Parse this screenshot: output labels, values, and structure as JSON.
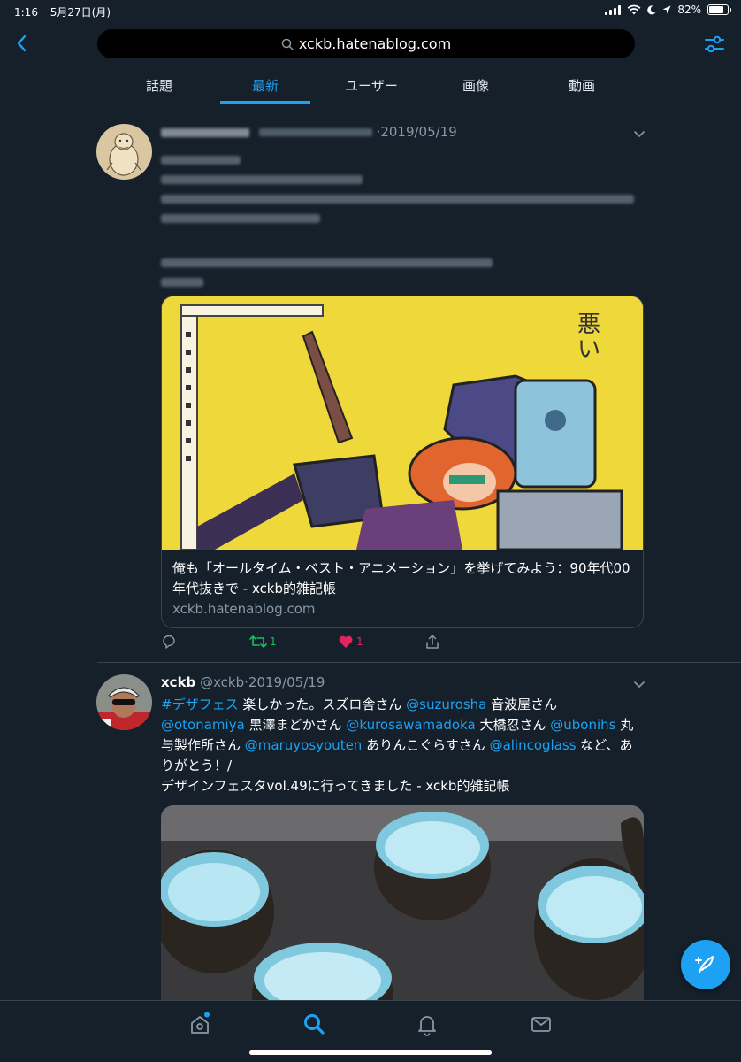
{
  "status_bar": {
    "time": "1:16",
    "date": "5月27日(月)",
    "battery_percent": "82%",
    "battery_level": 0.82
  },
  "header": {
    "search_text": "xckb.hatenablog.com",
    "icons": [
      "chevron-left-icon",
      "search-icon",
      "filter-sliders-icon"
    ]
  },
  "tabs": [
    {
      "label": "話題",
      "active": false
    },
    {
      "label": "最新",
      "active": true
    },
    {
      "label": "ユーザー",
      "active": false
    },
    {
      "label": "画像",
      "active": false
    },
    {
      "label": "動画",
      "active": false
    }
  ],
  "tweets": [
    {
      "name": "",
      "handle": "",
      "date": "·2019/05/19",
      "text_blurred": true,
      "card": {
        "title": "俺も「オールタイム・ベスト・アニメーション」を挙げてみよう：90年代00年代抜きで - xckb的雑記帳",
        "domain": "xckb.hatenablog.com"
      },
      "actions": {
        "reply_count": "",
        "retweet_count": "1",
        "like_count": "1",
        "liked": true
      }
    },
    {
      "name": "xckb",
      "handle": "@xckb",
      "date": "·2019/05/19",
      "text_segments": [
        {
          "text": "#デザフェス",
          "link": true
        },
        {
          "text": " 楽しかった。スズロ舎さん ",
          "link": false
        },
        {
          "text": "@suzurosha",
          "link": true
        },
        {
          "text": " 音波屋さん ",
          "link": false
        },
        {
          "text": "@otonamiya",
          "link": true
        },
        {
          "text": " 黒澤まどかさん ",
          "link": false
        },
        {
          "text": "@kurosawamadoka",
          "link": true
        },
        {
          "text": " 大橋忍さん ",
          "link": false
        },
        {
          "text": "@ubonihs",
          "link": true
        },
        {
          "text": " 丸与製作所さん ",
          "link": false
        },
        {
          "text": "@maruyosyouten",
          "link": true
        },
        {
          "text": " ありんこぐらすさん ",
          "link": false
        },
        {
          "text": "@alincoglass",
          "link": true
        },
        {
          "text": " など、ありがとう！/",
          "link": false
        }
      ],
      "text_line2": "デザインフェスタvol.49に行ってきました - xckb的雑記帳"
    }
  ],
  "bottom_nav": [
    "home-icon",
    "search-icon",
    "notifications-bell-icon",
    "messages-envelope-icon"
  ],
  "colors": {
    "background": "#15202b",
    "accent": "#1da1f2",
    "muted": "#8899a6",
    "border": "#38444d",
    "like": "#e0245e",
    "retweet": "#17bf63"
  }
}
